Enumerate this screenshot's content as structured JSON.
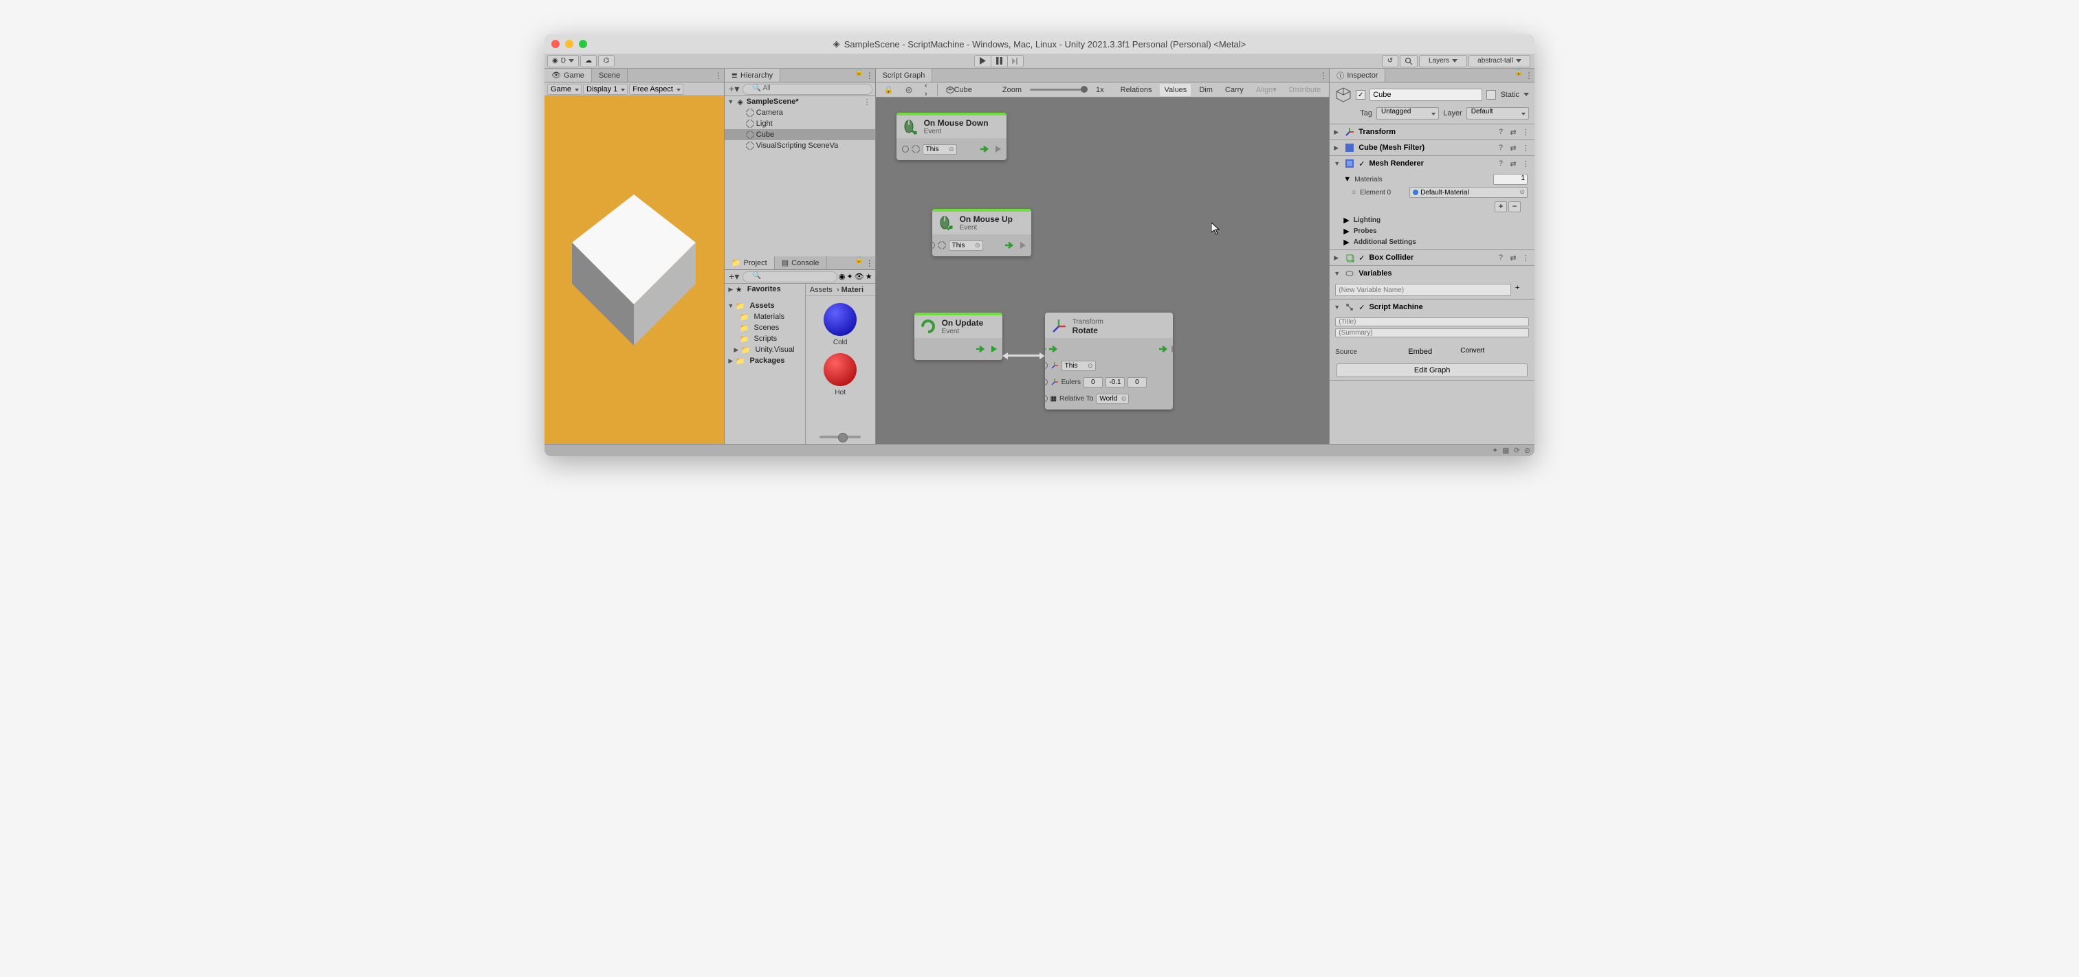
{
  "window": {
    "title": "SampleScene - ScriptMachine - Windows, Mac, Linux - Unity 2021.3.3f1 Personal (Personal) <Metal>"
  },
  "toolbar": {
    "account": "D",
    "layers": "Layers",
    "layout": "abstract-tall"
  },
  "game_panel": {
    "tab_game": "Game",
    "tab_scene": "Scene",
    "mode": "Game",
    "display": "Display 1",
    "aspect": "Free Aspect"
  },
  "hierarchy": {
    "tab": "Hierarchy",
    "search": "All",
    "scene": "SampleScene*",
    "items": [
      "Camera",
      "Light",
      "Cube",
      "VisualScripting SceneVa"
    ]
  },
  "project": {
    "tab_project": "Project",
    "tab_console": "Console",
    "tree": {
      "favorites": "Favorites",
      "assets": "Assets",
      "assets_children": [
        "Materials",
        "Scenes",
        "Scripts",
        "Unity.Visual"
      ],
      "packages": "Packages"
    },
    "breadcrumb": "Assets > Materi",
    "assets": [
      {
        "name": "Cold",
        "color": "blue"
      },
      {
        "name": "Hot",
        "color": "red"
      }
    ]
  },
  "graph": {
    "tab": "Script Graph",
    "context": "Cube",
    "zoom_label": "Zoom",
    "zoom_value": "1x",
    "toolbar_items": [
      "Relations",
      "Values",
      "Dim",
      "Carry",
      "Align",
      "Distribute"
    ],
    "nodes": {
      "n1": {
        "title": "On Mouse Down",
        "sub": "Event",
        "target": "This"
      },
      "n2": {
        "title": "On Mouse Up",
        "sub": "Event",
        "target": "This"
      },
      "n3": {
        "title": "On Update",
        "sub": "Event"
      },
      "n4": {
        "title_pre": "Transform",
        "title": "Rotate",
        "target": "This",
        "eulers_label": "Eulers",
        "eulers": [
          "0",
          "-0.1",
          "0"
        ],
        "rel_label": "Relative To",
        "rel_value": "World"
      }
    }
  },
  "inspector": {
    "tab": "Inspector",
    "name": "Cube",
    "static": "Static",
    "tag_label": "Tag",
    "tag_value": "Untagged",
    "layer_label": "Layer",
    "layer_value": "Default",
    "components": {
      "transform": "Transform",
      "meshfilter": "Cube (Mesh Filter)",
      "meshrenderer": "Mesh Renderer",
      "materials_label": "Materials",
      "materials_count": "1",
      "element0_label": "Element 0",
      "element0_value": "Default-Material",
      "lighting": "Lighting",
      "probes": "Probes",
      "addsettings": "Additional Settings",
      "boxcollider": "Box Collider",
      "variables": "Variables",
      "newvar": "(New Variable Name)",
      "scriptmachine": "Script Machine",
      "title_ph": "(Title)",
      "summary_ph": "(Summary)",
      "source_label": "Source",
      "source_value": "Embed",
      "convert": "Convert",
      "editgraph": "Edit Graph"
    }
  }
}
